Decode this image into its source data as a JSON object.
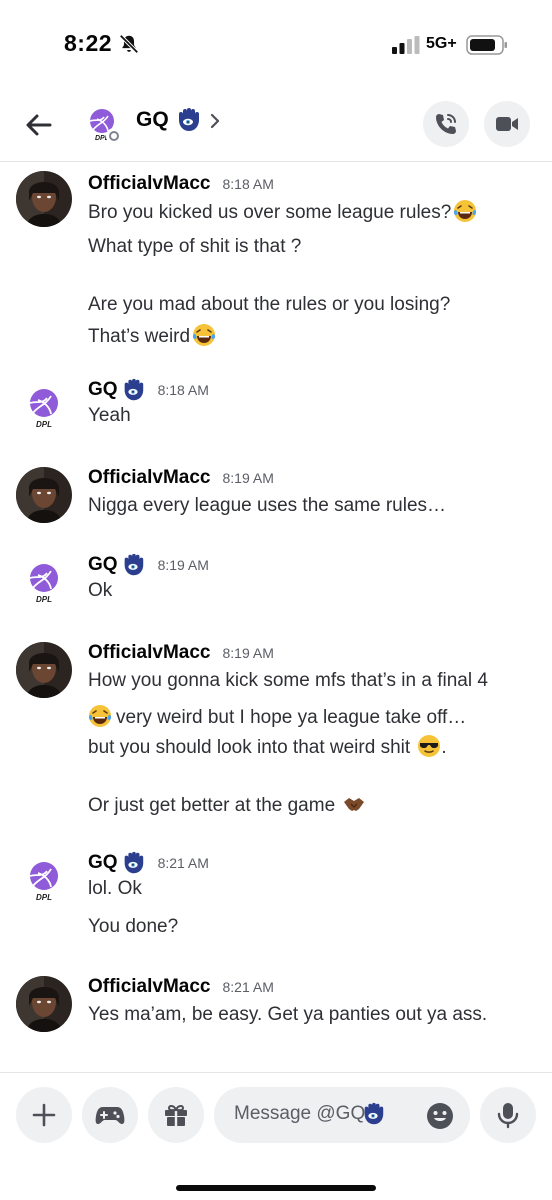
{
  "status_bar": {
    "time": "8:22",
    "network": "5G+"
  },
  "header": {
    "channel_name": "GQ"
  },
  "messages": [
    {
      "author": "OfficialvMacc",
      "timestamp": "8:18 AM",
      "avatar": "dark-portrait-avatar",
      "lines": [
        "Bro you kicked us over some league rules?",
        "What type of shit is that ?",
        "Are you mad about the rules or you losing?",
        "That’s weird"
      ]
    },
    {
      "author": "GQ",
      "timestamp": "8:18 AM",
      "avatar": "dpl-basketball-logo",
      "lines": [
        "Yeah"
      ]
    },
    {
      "author": "OfficialvMacc",
      "timestamp": "8:19 AM",
      "avatar": "dark-portrait-avatar",
      "lines": [
        "Nigga every league uses the same rules…"
      ]
    },
    {
      "author": "GQ",
      "timestamp": "8:19 AM",
      "avatar": "dpl-basketball-logo",
      "lines": [
        "Ok"
      ]
    },
    {
      "author": "OfficialvMacc",
      "timestamp": "8:19 AM",
      "avatar": "dark-portrait-avatar",
      "lines": [
        "How you gonna kick some mfs that’s in a final 4",
        "very weird but I hope ya league take off…",
        "but you should look into that weird shit",
        ".",
        "Or just get better at the game"
      ]
    },
    {
      "author": "GQ",
      "timestamp": "8:21 AM",
      "avatar": "dpl-basketball-logo",
      "lines": [
        "lol. Ok",
        "You done?"
      ]
    },
    {
      "author": "OfficialvMacc",
      "timestamp": "8:21 AM",
      "avatar": "dark-portrait-avatar",
      "lines": [
        "Yes ma’am, be easy. Get ya panties out ya ass."
      ]
    }
  ],
  "composer": {
    "placeholder": "Message @GQ"
  },
  "logo_text": "DPL",
  "colors": {
    "accent": "#7b5cd6",
    "logo_purple": "#8f5bd9",
    "hamsa_blue": "#2c3f8f",
    "icon_bg": "#eef0f2"
  }
}
